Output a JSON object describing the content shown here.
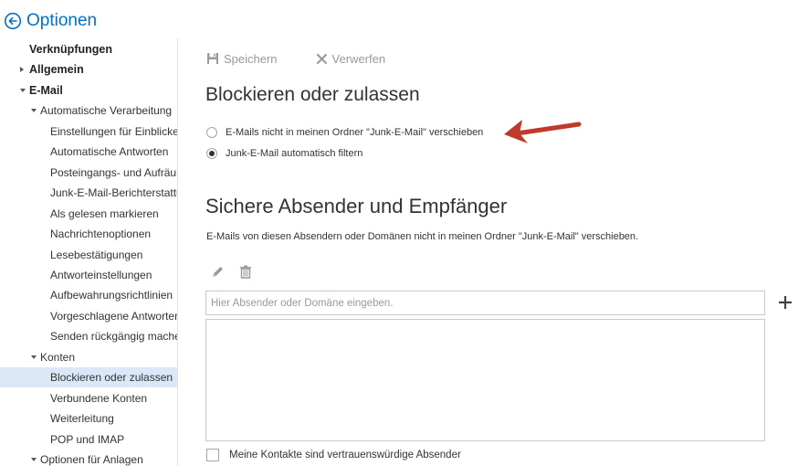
{
  "header": {
    "title": "Optionen",
    "back_icon": "back-arrow-circle-icon",
    "accent": "#0072c6"
  },
  "sidebar": {
    "items": [
      {
        "label": "Verknüpfungen",
        "level": 0,
        "caret": "none"
      },
      {
        "label": "Allgemein",
        "level": 0,
        "caret": "collapsed"
      },
      {
        "label": "E-Mail",
        "level": 0,
        "caret": "expanded"
      },
      {
        "label": "Automatische Verarbeitung",
        "level": 1,
        "caret": "expanded"
      },
      {
        "label": "Einstellungen für Einblicke",
        "level": 2,
        "caret": "none"
      },
      {
        "label": "Automatische Antworten",
        "level": 2,
        "caret": "none"
      },
      {
        "label": "Posteingangs- und Aufräumregeln",
        "level": 2,
        "caret": "none"
      },
      {
        "label": "Junk-E-Mail-Berichterstattung",
        "level": 2,
        "caret": "none"
      },
      {
        "label": "Als gelesen markieren",
        "level": 2,
        "caret": "none"
      },
      {
        "label": "Nachrichtenoptionen",
        "level": 2,
        "caret": "none"
      },
      {
        "label": "Lesebestätigungen",
        "level": 2,
        "caret": "none"
      },
      {
        "label": "Antworteinstellungen",
        "level": 2,
        "caret": "none"
      },
      {
        "label": "Aufbewahrungsrichtlinien",
        "level": 2,
        "caret": "none"
      },
      {
        "label": "Vorgeschlagene Antworten",
        "level": 2,
        "caret": "none"
      },
      {
        "label": "Senden rückgängig machen",
        "level": 2,
        "caret": "none"
      },
      {
        "label": "Konten",
        "level": 1,
        "caret": "expanded"
      },
      {
        "label": "Blockieren oder zulassen",
        "level": 2,
        "caret": "none",
        "selected": true
      },
      {
        "label": "Verbundene Konten",
        "level": 2,
        "caret": "none"
      },
      {
        "label": "Weiterleitung",
        "level": 2,
        "caret": "none"
      },
      {
        "label": "POP und IMAP",
        "level": 2,
        "caret": "none"
      },
      {
        "label": "Optionen für Anlagen",
        "level": 1,
        "caret": "expanded"
      }
    ],
    "selected_color": "#dae8f8"
  },
  "toolbar": {
    "save_label": "Speichern",
    "discard_label": "Verwerfen"
  },
  "main": {
    "title": "Blockieren oder zulassen",
    "radio_options": [
      {
        "label": "E-Mails nicht in meinen Ordner \"Junk-E-Mail\" verschieben",
        "checked": false
      },
      {
        "label": "Junk-E-Mail automatisch filtern",
        "checked": true
      }
    ],
    "safe_section": {
      "title": "Sichere Absender und Empfänger",
      "description": "E-Mails von diesen Absendern oder Domänen nicht in meinen Ordner \"Junk-E-Mail\" verschieben.",
      "input_placeholder": "Hier Absender oder Domäne eingeben.",
      "input_value": "",
      "checkbox_label": "Meine Kontakte sind vertrauenswürdige Absender",
      "checkbox_checked": false
    }
  },
  "annotation": {
    "arrow_color": "#c0392b"
  }
}
